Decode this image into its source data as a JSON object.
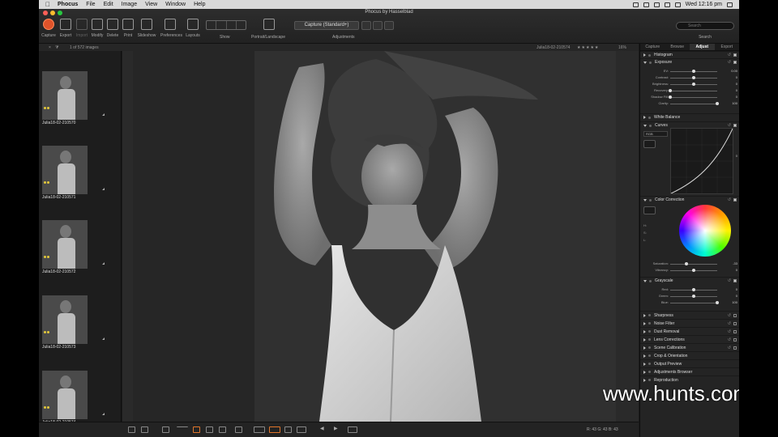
{
  "menubar": {
    "app": "Phocus",
    "items": [
      "File",
      "Edit",
      "Image",
      "View",
      "Window",
      "Help"
    ],
    "clock": "Wed 12:16 pm"
  },
  "window": {
    "title": "Phocus by Hasselblad"
  },
  "toolbar": {
    "capture": "Capture",
    "export": "Export",
    "import": "Import",
    "modify": "Modify",
    "delete": "Delete",
    "print": "Print",
    "slideshow": "Slideshow",
    "preferences": "Preferences",
    "layouts": "Layouts",
    "show": "Show",
    "portrait": "Portrait/Landscape",
    "adjustments_preset": "Capture (Standard+)",
    "adjustments": "Adjustments",
    "search_placeholder": "Search",
    "search": "Search"
  },
  "substrip": {
    "count": "1 of 572 images",
    "filename": "Julia18-02-210574",
    "rating": "★★★★★",
    "zoom": "16%"
  },
  "thumbs": [
    {
      "name": "Julia18-02-210570"
    },
    {
      "name": "Julia18-02-210571"
    },
    {
      "name": "Julia18-02-210572"
    },
    {
      "name": "Julia18-02-210573"
    },
    {
      "name": "Julia18-02-210574"
    }
  ],
  "tools": {
    "tabs": [
      "Capture",
      "Browse",
      "Adjust",
      "Export"
    ],
    "histogram": "Histogram",
    "exposure": {
      "title": "Exposure",
      "sliders": [
        {
          "name": "EV:",
          "value": "0.00",
          "pos": 0.5
        },
        {
          "name": "Contrast:",
          "value": "0",
          "pos": 0.5
        },
        {
          "name": "Brightness:",
          "value": "0",
          "pos": 0.5
        },
        {
          "name": "Recovery:",
          "value": "0",
          "pos": 0.0
        },
        {
          "name": "Shadow Fill:",
          "value": "0",
          "pos": 0.0
        },
        {
          "name": "Clarity:",
          "value": "100",
          "pos": 1.0
        }
      ]
    },
    "white_balance": "White Balance",
    "curves": {
      "title": "Curves",
      "channel": "RGB",
      "value_right": "0"
    },
    "color_correction": {
      "title": "Color Correction",
      "hsl": [
        "H:",
        "S:",
        "L:"
      ],
      "sliders": [
        {
          "name": "Saturation:",
          "value": "-33",
          "pos": 0.35
        },
        {
          "name": "Vibrancy:",
          "value": "0",
          "pos": 0.5
        }
      ]
    },
    "grayscale": {
      "title": "Grayscale",
      "sliders": [
        {
          "name": "Red:",
          "value": "0",
          "pos": 0.5
        },
        {
          "name": "Green:",
          "value": "0",
          "pos": 0.5
        },
        {
          "name": "Blue:",
          "value": "100",
          "pos": 1.0
        }
      ]
    },
    "closed": [
      "Sharpness",
      "Noise Filter",
      "Dust Removal",
      "Lens Corrections",
      "Scene Calibration",
      "Crop & Orientation",
      "Output Preview",
      "Adjustments Browser",
      "Reproduction"
    ],
    "reset": "↺"
  },
  "bottombar": {
    "status": "R: 43  G: 43  B: 43"
  },
  "watermark": "www.hunts.com"
}
